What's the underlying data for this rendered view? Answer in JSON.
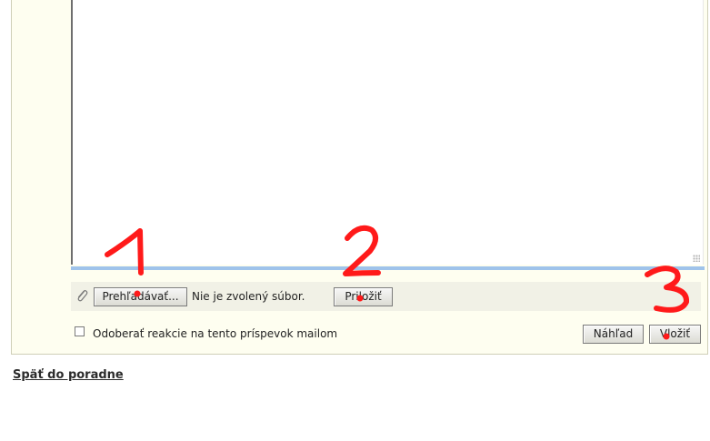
{
  "form": {
    "message_textarea_value": "",
    "attach": {
      "browse_label": "Prehľadávať...",
      "file_status": "Nie je zvolený súbor.",
      "attach_label": "Priložiť"
    },
    "subscribe": {
      "label": "Odoberať reakcie na tento príspevok mailom",
      "checked": false
    },
    "preview_label": "Náhľad",
    "insert_label": "Vložiť"
  },
  "navigation": {
    "back_link": "Späť do poradne"
  },
  "annotations": {
    "color": "#ff1a1a",
    "marks": [
      "1",
      "2",
      "3"
    ]
  },
  "colors": {
    "panel_bg": "#fefef0",
    "editor_bar": "#9fc3ea",
    "attach_row_bg": "#f1f1e6"
  }
}
